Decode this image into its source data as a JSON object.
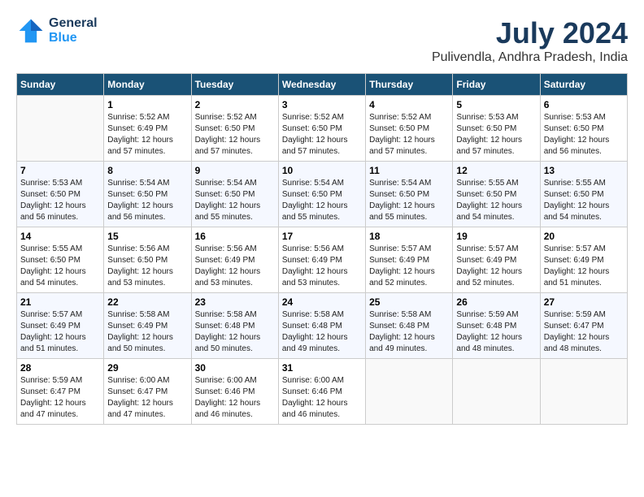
{
  "logo": {
    "line1": "General",
    "line2": "Blue"
  },
  "title": "July 2024",
  "location": "Pulivendla, Andhra Pradesh, India",
  "weekdays": [
    "Sunday",
    "Monday",
    "Tuesday",
    "Wednesday",
    "Thursday",
    "Friday",
    "Saturday"
  ],
  "weeks": [
    [
      {
        "day": "",
        "empty": true
      },
      {
        "day": "1",
        "sunrise": "5:52 AM",
        "sunset": "6:49 PM",
        "daylight": "12 hours and 57 minutes."
      },
      {
        "day": "2",
        "sunrise": "5:52 AM",
        "sunset": "6:50 PM",
        "daylight": "12 hours and 57 minutes."
      },
      {
        "day": "3",
        "sunrise": "5:52 AM",
        "sunset": "6:50 PM",
        "daylight": "12 hours and 57 minutes."
      },
      {
        "day": "4",
        "sunrise": "5:52 AM",
        "sunset": "6:50 PM",
        "daylight": "12 hours and 57 minutes."
      },
      {
        "day": "5",
        "sunrise": "5:53 AM",
        "sunset": "6:50 PM",
        "daylight": "12 hours and 57 minutes."
      },
      {
        "day": "6",
        "sunrise": "5:53 AM",
        "sunset": "6:50 PM",
        "daylight": "12 hours and 56 minutes."
      }
    ],
    [
      {
        "day": "7",
        "sunrise": "5:53 AM",
        "sunset": "6:50 PM",
        "daylight": "12 hours and 56 minutes."
      },
      {
        "day": "8",
        "sunrise": "5:54 AM",
        "sunset": "6:50 PM",
        "daylight": "12 hours and 56 minutes."
      },
      {
        "day": "9",
        "sunrise": "5:54 AM",
        "sunset": "6:50 PM",
        "daylight": "12 hours and 55 minutes."
      },
      {
        "day": "10",
        "sunrise": "5:54 AM",
        "sunset": "6:50 PM",
        "daylight": "12 hours and 55 minutes."
      },
      {
        "day": "11",
        "sunrise": "5:54 AM",
        "sunset": "6:50 PM",
        "daylight": "12 hours and 55 minutes."
      },
      {
        "day": "12",
        "sunrise": "5:55 AM",
        "sunset": "6:50 PM",
        "daylight": "12 hours and 54 minutes."
      },
      {
        "day": "13",
        "sunrise": "5:55 AM",
        "sunset": "6:50 PM",
        "daylight": "12 hours and 54 minutes."
      }
    ],
    [
      {
        "day": "14",
        "sunrise": "5:55 AM",
        "sunset": "6:50 PM",
        "daylight": "12 hours and 54 minutes."
      },
      {
        "day": "15",
        "sunrise": "5:56 AM",
        "sunset": "6:50 PM",
        "daylight": "12 hours and 53 minutes."
      },
      {
        "day": "16",
        "sunrise": "5:56 AM",
        "sunset": "6:49 PM",
        "daylight": "12 hours and 53 minutes."
      },
      {
        "day": "17",
        "sunrise": "5:56 AM",
        "sunset": "6:49 PM",
        "daylight": "12 hours and 53 minutes."
      },
      {
        "day": "18",
        "sunrise": "5:57 AM",
        "sunset": "6:49 PM",
        "daylight": "12 hours and 52 minutes."
      },
      {
        "day": "19",
        "sunrise": "5:57 AM",
        "sunset": "6:49 PM",
        "daylight": "12 hours and 52 minutes."
      },
      {
        "day": "20",
        "sunrise": "5:57 AM",
        "sunset": "6:49 PM",
        "daylight": "12 hours and 51 minutes."
      }
    ],
    [
      {
        "day": "21",
        "sunrise": "5:57 AM",
        "sunset": "6:49 PM",
        "daylight": "12 hours and 51 minutes."
      },
      {
        "day": "22",
        "sunrise": "5:58 AM",
        "sunset": "6:49 PM",
        "daylight": "12 hours and 50 minutes."
      },
      {
        "day": "23",
        "sunrise": "5:58 AM",
        "sunset": "6:48 PM",
        "daylight": "12 hours and 50 minutes."
      },
      {
        "day": "24",
        "sunrise": "5:58 AM",
        "sunset": "6:48 PM",
        "daylight": "12 hours and 49 minutes."
      },
      {
        "day": "25",
        "sunrise": "5:58 AM",
        "sunset": "6:48 PM",
        "daylight": "12 hours and 49 minutes."
      },
      {
        "day": "26",
        "sunrise": "5:59 AM",
        "sunset": "6:48 PM",
        "daylight": "12 hours and 48 minutes."
      },
      {
        "day": "27",
        "sunrise": "5:59 AM",
        "sunset": "6:47 PM",
        "daylight": "12 hours and 48 minutes."
      }
    ],
    [
      {
        "day": "28",
        "sunrise": "5:59 AM",
        "sunset": "6:47 PM",
        "daylight": "12 hours and 47 minutes."
      },
      {
        "day": "29",
        "sunrise": "6:00 AM",
        "sunset": "6:47 PM",
        "daylight": "12 hours and 47 minutes."
      },
      {
        "day": "30",
        "sunrise": "6:00 AM",
        "sunset": "6:46 PM",
        "daylight": "12 hours and 46 minutes."
      },
      {
        "day": "31",
        "sunrise": "6:00 AM",
        "sunset": "6:46 PM",
        "daylight": "12 hours and 46 minutes."
      },
      {
        "day": "",
        "empty": true
      },
      {
        "day": "",
        "empty": true
      },
      {
        "day": "",
        "empty": true
      }
    ]
  ]
}
